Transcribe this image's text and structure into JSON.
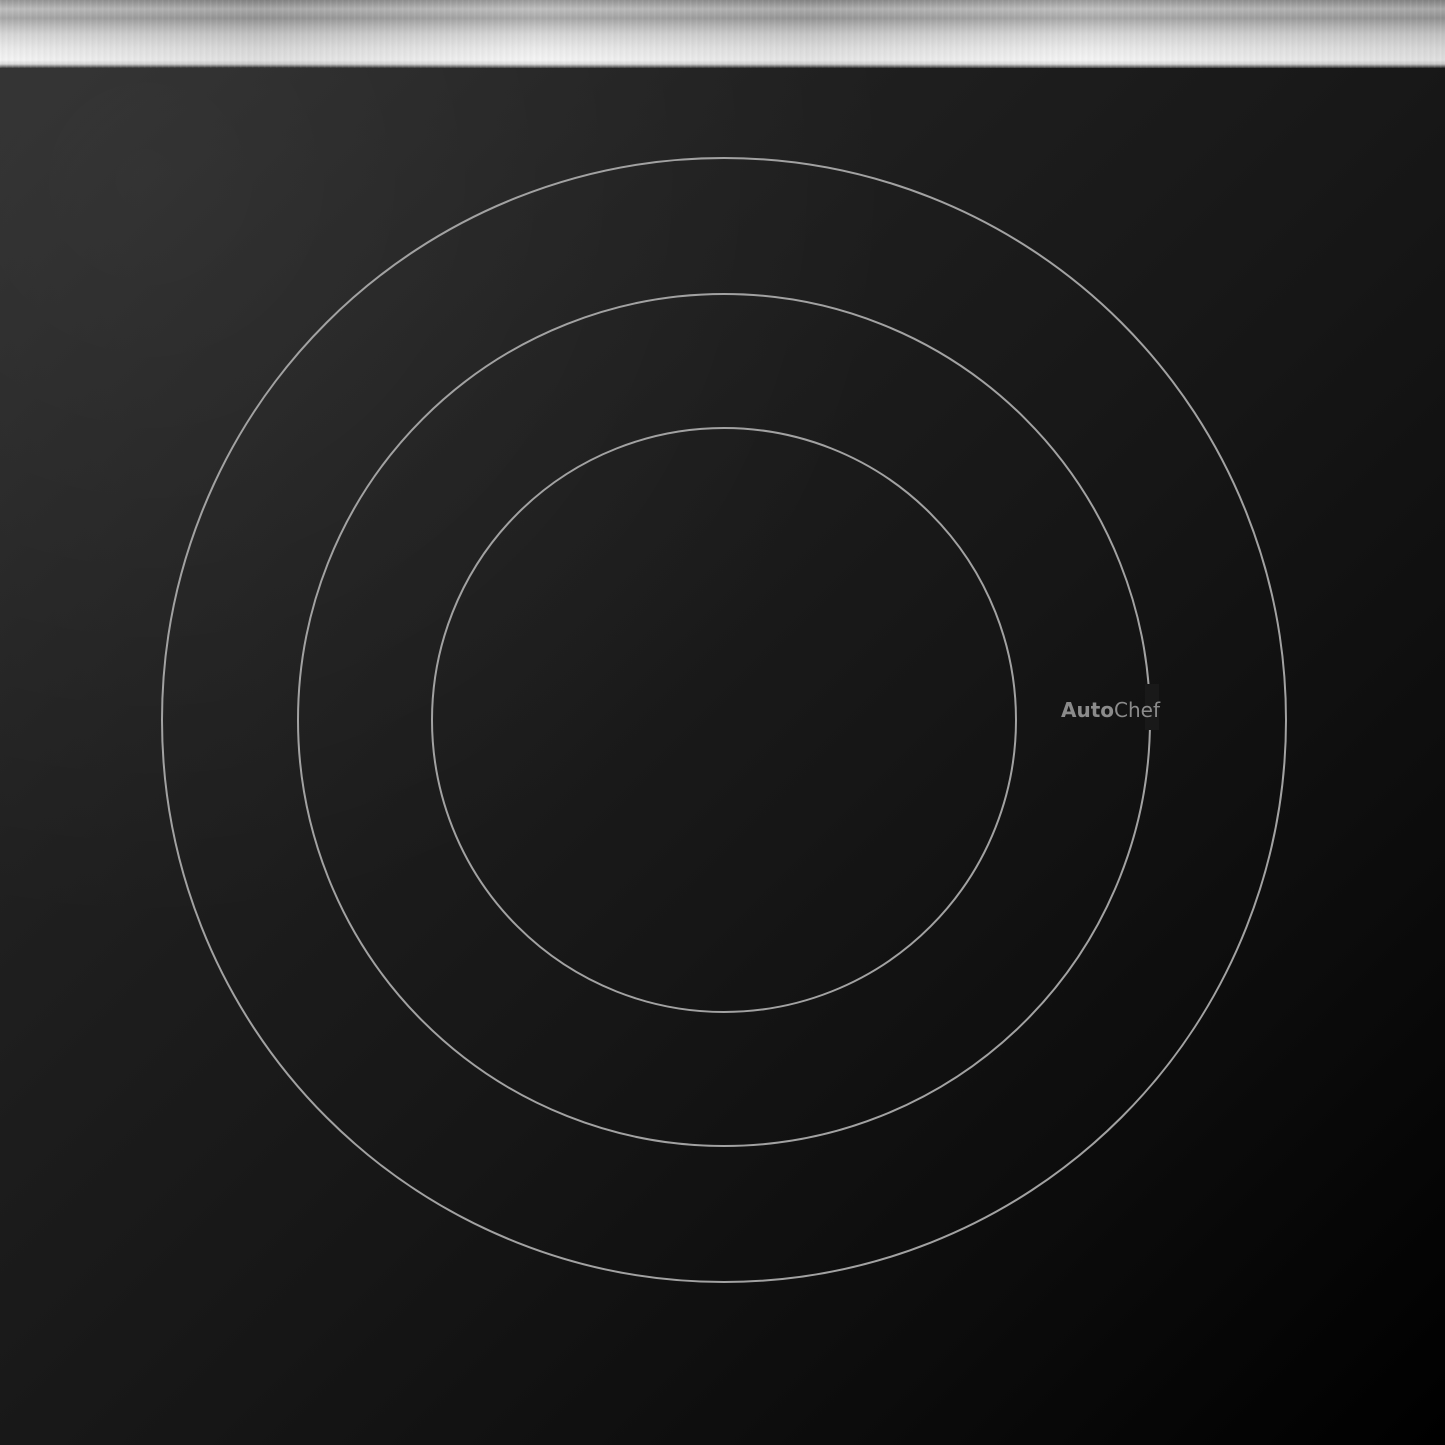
{
  "cooktop": {
    "brand_bold": "Auto",
    "brand_regular": "Chef",
    "ring_color": "#a2a2a2",
    "glass_color": "#161616",
    "trim_color": "#d8d8d8"
  },
  "icons": {
    "cooking_zone_icon": "concentric-circle-icon"
  }
}
